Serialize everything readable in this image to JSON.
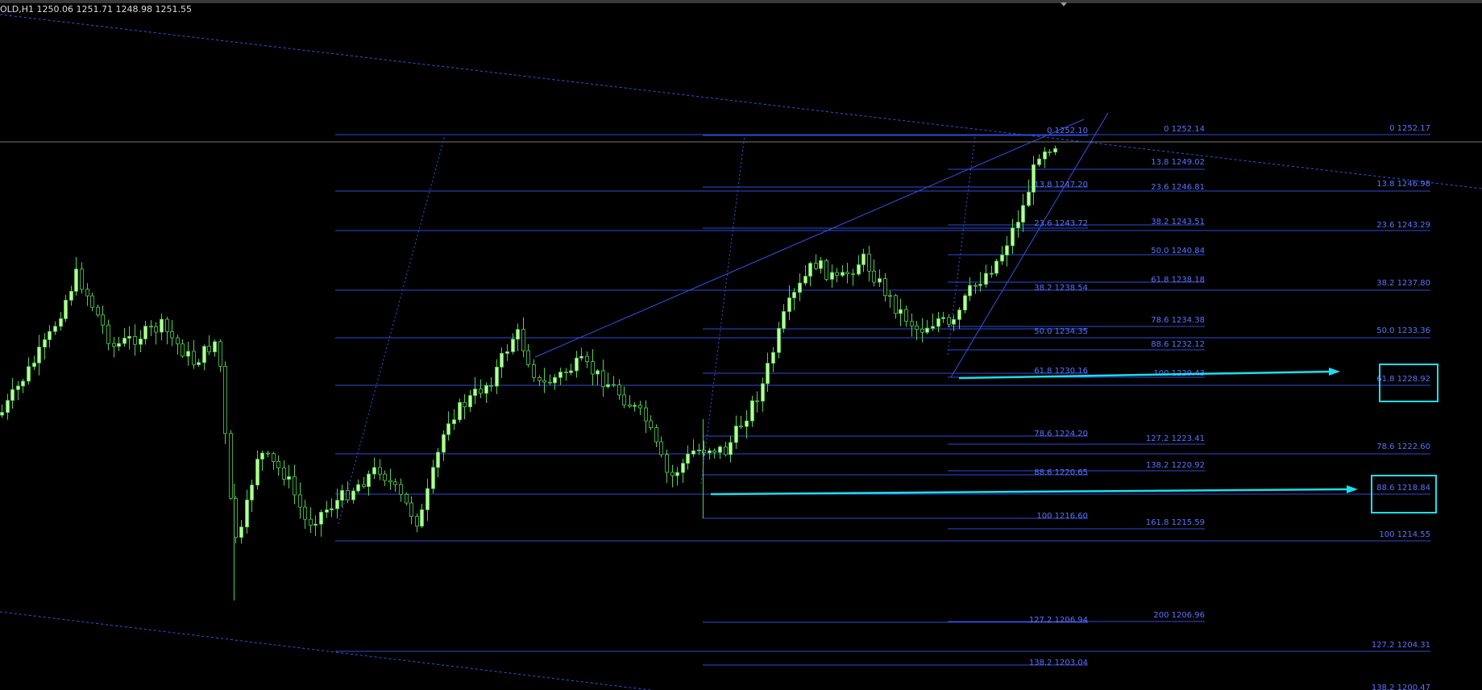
{
  "header": {
    "symbol_info": "OLD,H1  1250.06 1251.71 1248.98 1251.55"
  },
  "colors": {
    "background": "#000000",
    "fib_line": "#2e4bd6",
    "fib_text": "#5b72ff",
    "trend_line": "#3452e8",
    "bull_candle": "#b9ff9a",
    "bear_candle": "#000000",
    "wick": "#4fd34f",
    "highlight": "#19e0f0",
    "crosshair": "#c8c8c8"
  },
  "fib_groups": {
    "group_a": [
      "13.8 1247.20",
      "23.6 1243.72",
      "38.2 1238.54",
      "50.0 1234.35",
      "61.8 1230.16",
      "78.6 1224.20",
      "88.6 1220.65",
      "100 1216.60",
      "127.2 1206.94",
      "138.2 1203.04"
    ],
    "group_b": [
      "0 1252.14",
      "13.8 1249.02",
      "23.6 1246.81",
      "38.2 1243.51",
      "50.0 1240.84",
      "61.8 1238.18",
      "78.6 1234.38",
      "88.6 1232.12",
      "100 1229.43",
      "127.2 1223.41",
      "138.2 1220.92",
      "161.8 1215.59",
      "200 1206.96"
    ],
    "group_c": [
      "0 1252.17",
      "13.8 1246.98",
      "23.6 1243.29",
      "38.2 1237.80",
      "50.0 1233.36",
      "61.8 1228.92",
      "78.6 1222.60",
      "88.6 1218.84",
      "100 1214.55",
      "127.2 1204.31",
      "138.2 1200.47"
    ],
    "top_label": "0 1252.10"
  },
  "highlights": [
    "61.8 1228.92",
    "88.6 1218.84"
  ]
}
